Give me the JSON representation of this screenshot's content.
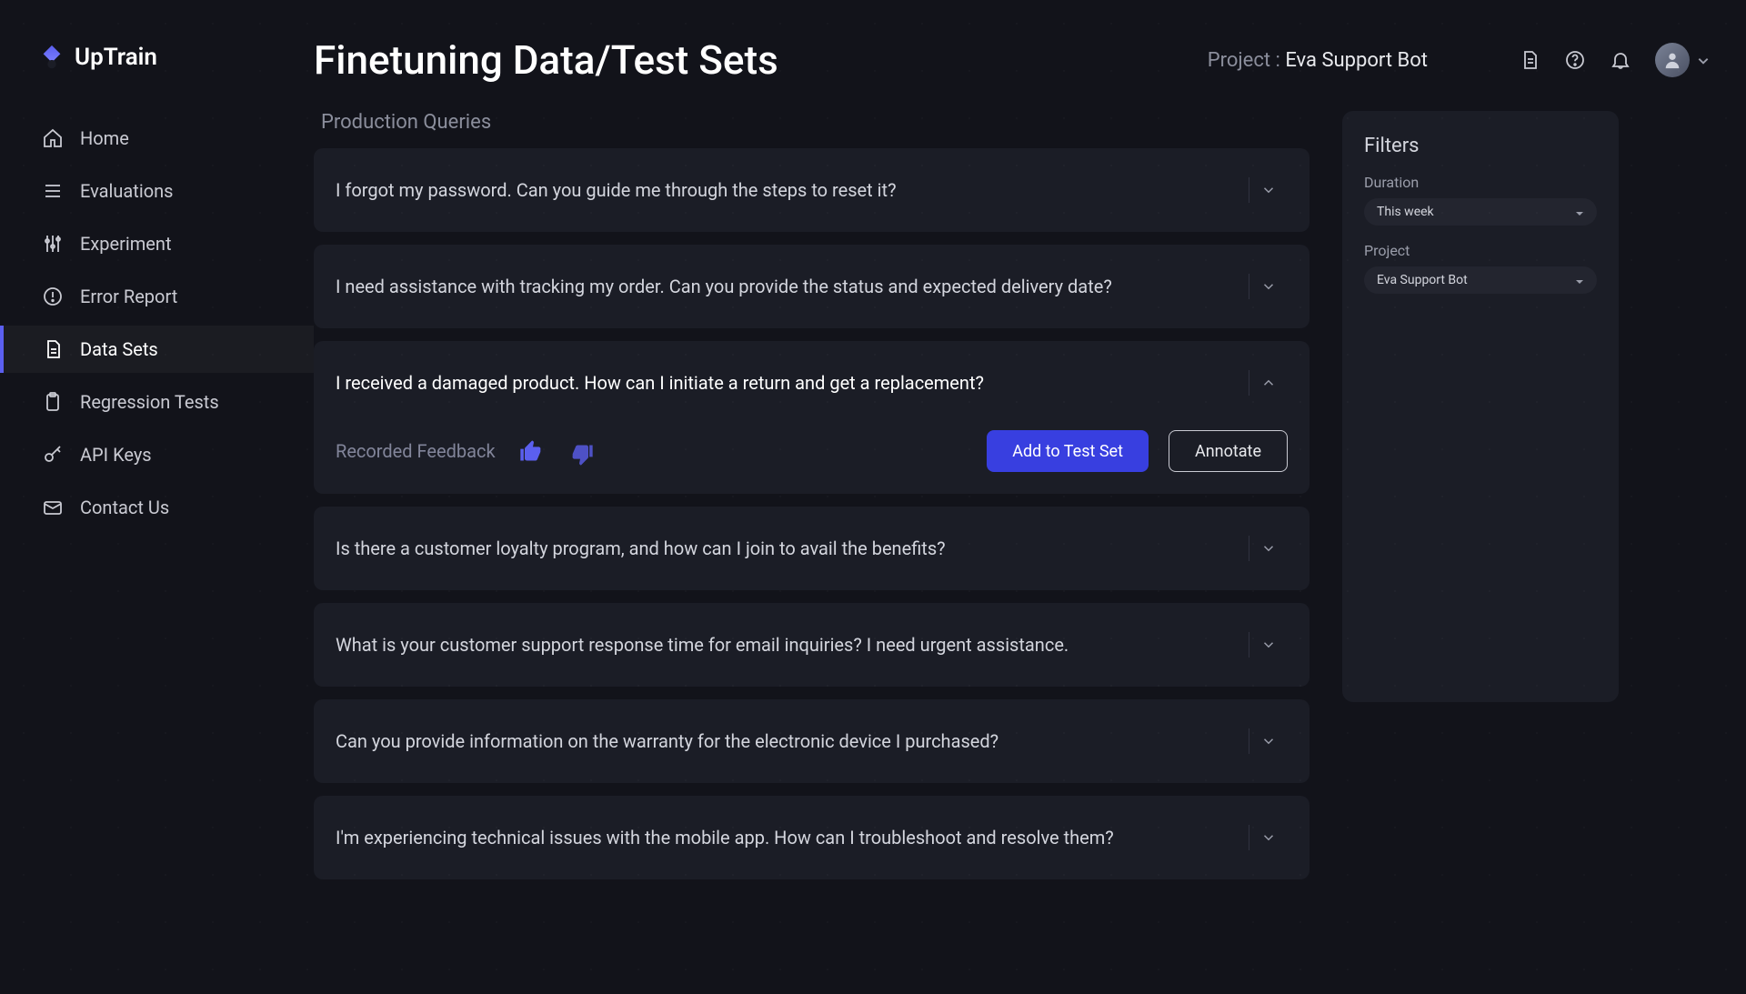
{
  "brand": "UpTrain",
  "sidebar": {
    "items": [
      {
        "label": "Home",
        "icon": "home"
      },
      {
        "label": "Evaluations",
        "icon": "list"
      },
      {
        "label": "Experiment",
        "icon": "sliders"
      },
      {
        "label": "Error Report",
        "icon": "alert"
      },
      {
        "label": "Data Sets",
        "icon": "document",
        "active": true
      },
      {
        "label": "Regression Tests",
        "icon": "clipboard"
      },
      {
        "label": "API Keys",
        "icon": "key"
      },
      {
        "label": "Contact Us",
        "icon": "mail"
      }
    ]
  },
  "header": {
    "title": "Finetuning Data/Test Sets",
    "project_prefix": "Project : ",
    "project_name": "Eva Support Bot"
  },
  "section_label": "Production Queries",
  "queries": [
    {
      "text": "I forgot my password. Can you guide me through the steps to reset it?"
    },
    {
      "text": "I need assistance with tracking my order. Can you provide the status and expected delivery date?"
    },
    {
      "text": "I received a damaged product. How can I initiate a return and get a replacement?",
      "expanded": true
    },
    {
      "text": "Is there a customer loyalty program, and how can I join to avail the benefits?"
    },
    {
      "text": "What is your customer support response time for email inquiries? I need urgent assistance."
    },
    {
      "text": "Can you provide information on the warranty for the electronic device I purchased?"
    },
    {
      "text": "I'm experiencing technical issues with the mobile app. How can I troubleshoot and resolve them?"
    }
  ],
  "expanded": {
    "feedback_label": "Recorded Feedback",
    "add_to_test_set": "Add to Test Set",
    "annotate": "Annotate"
  },
  "filters": {
    "title": "Filters",
    "duration_label": "Duration",
    "duration_value": "This week",
    "project_label": "Project",
    "project_value": "Eva Support Bot"
  }
}
